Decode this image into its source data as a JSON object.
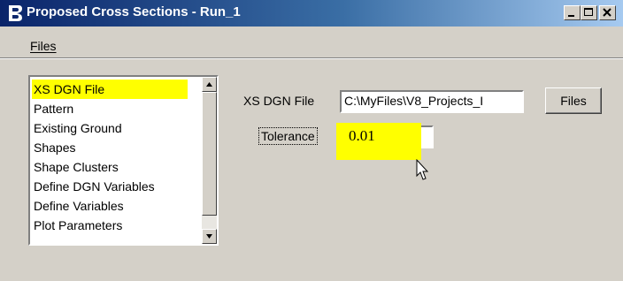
{
  "window": {
    "title": "Proposed Cross Sections - Run_1",
    "app_icon": "bentley-b-icon",
    "controls": [
      "minimize-icon",
      "maximize-icon",
      "close-icon"
    ]
  },
  "menu": {
    "files": "Files"
  },
  "categories": [
    "XS DGN File",
    "Pattern",
    "Existing Ground",
    "Shapes",
    "Shape Clusters",
    "Define DGN Variables",
    "Define Variables",
    "Plot Parameters"
  ],
  "selected_category": "XS DGN File",
  "form": {
    "xs_dgn_label": "XS DGN File",
    "xs_dgn_value": "C:\\MyFiles\\V8_Projects_I",
    "files_button": "Files",
    "tolerance_label": "Tolerance",
    "tolerance_value": "0.01"
  },
  "colors": {
    "highlight": "#ffff00",
    "titlebar": "#0a246a",
    "face": "#d4d0c8"
  }
}
